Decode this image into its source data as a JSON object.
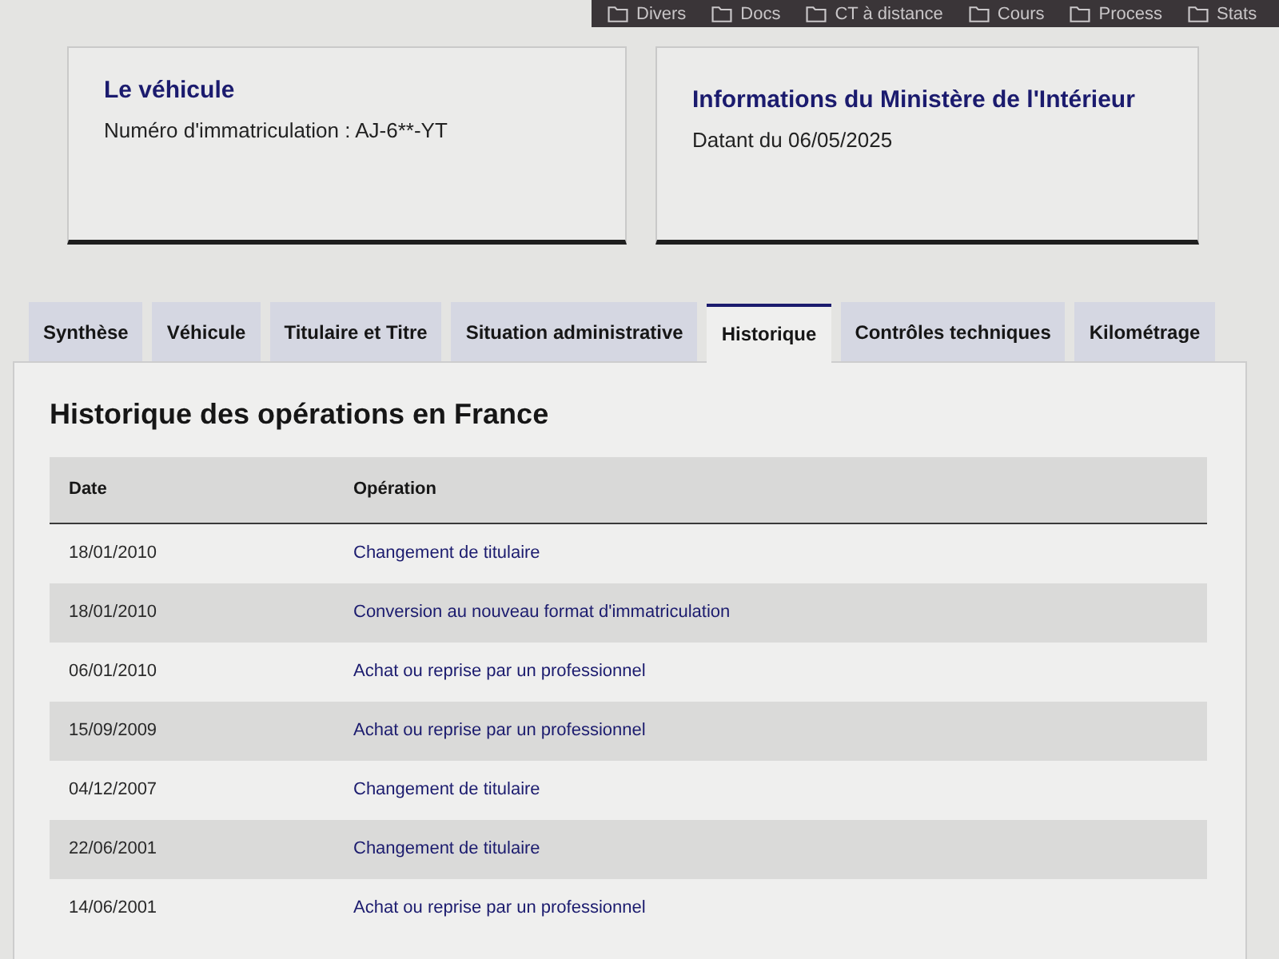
{
  "bookmarks": [
    {
      "label": "Divers"
    },
    {
      "label": "Docs"
    },
    {
      "label": "CT à distance"
    },
    {
      "label": "Cours"
    },
    {
      "label": "Process"
    },
    {
      "label": "Stats"
    }
  ],
  "cards": [
    {
      "title": "Le véhicule",
      "text": "Numéro d'immatriculation : AJ-6**-YT"
    },
    {
      "title": "Informations du Ministère de l'Intérieur",
      "text": "Datant du 06/05/2025"
    }
  ],
  "tabs": [
    {
      "label": "Synthèse",
      "selected": false
    },
    {
      "label": "Véhicule",
      "selected": false
    },
    {
      "label": "Titulaire et Titre",
      "selected": false
    },
    {
      "label": "Situation administrative",
      "selected": false
    },
    {
      "label": "Historique",
      "selected": true
    },
    {
      "label": "Contrôles techniques",
      "selected": false
    },
    {
      "label": "Kilométrage",
      "selected": false
    }
  ],
  "panel": {
    "heading": "Historique des opérations en France",
    "table": {
      "columns": [
        "Date",
        "Opération"
      ],
      "rows": [
        [
          "18/01/2010",
          "Changement de titulaire"
        ],
        [
          "18/01/2010",
          "Conversion au nouveau format d'immatriculation"
        ],
        [
          "06/01/2010",
          "Achat ou reprise par un professionnel"
        ],
        [
          "15/09/2009",
          "Achat ou reprise par un professionnel"
        ],
        [
          "04/12/2007",
          "Changement de titulaire"
        ],
        [
          "22/06/2001",
          "Changement de titulaire"
        ],
        [
          "14/06/2001",
          "Achat ou reprise par un professionnel"
        ]
      ]
    }
  }
}
